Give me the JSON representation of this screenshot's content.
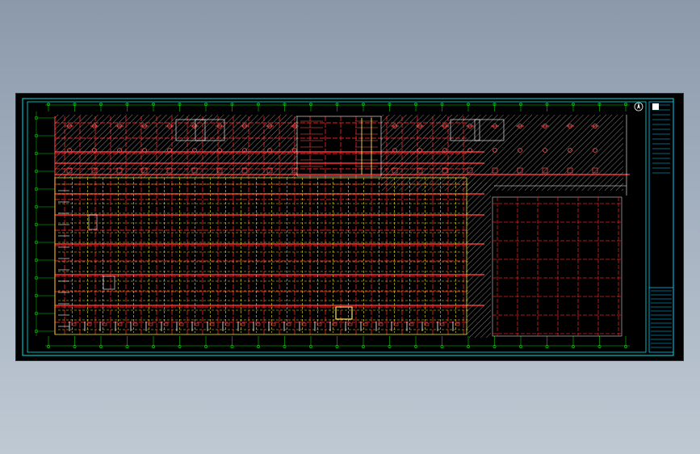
{
  "app": {
    "view": "cad-drawing-viewport"
  },
  "colors": {
    "background": "#000000",
    "frame": "#00e5e5",
    "axis": "#00d000",
    "grid_primary": "#e02020",
    "grid_secondary": "#e8e020",
    "hatch": "#b0b0b0",
    "detail": "#ffffff",
    "title_block": "#00c8ff"
  },
  "icons": {
    "north_symbol": "north-arrow-icon"
  }
}
